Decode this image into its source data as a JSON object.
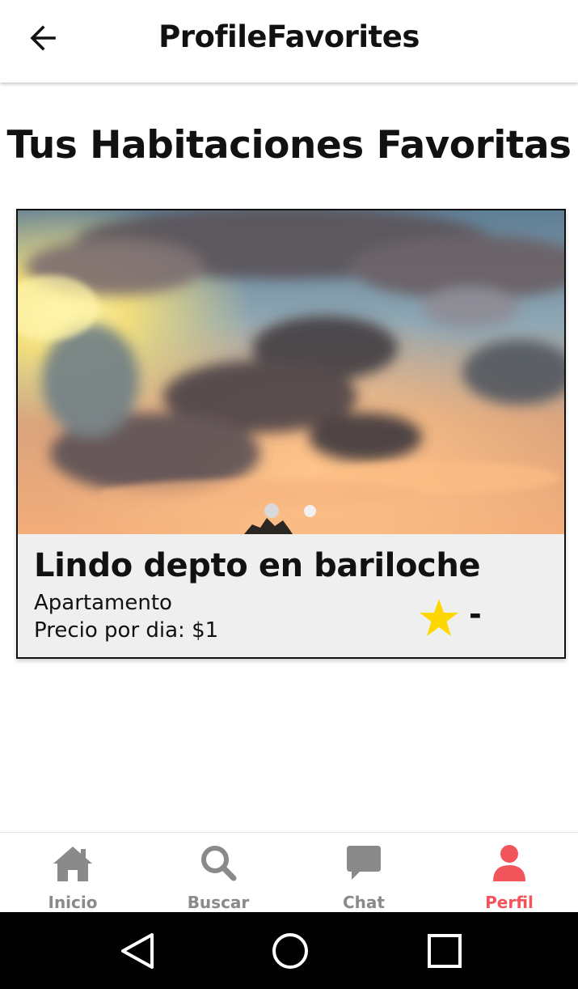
{
  "header": {
    "title": "ProfileFavorites",
    "back_icon": "arrow-left-icon"
  },
  "page": {
    "heading": "Tus Habitaciones Favoritas"
  },
  "favorites": [
    {
      "title": "Lindo depto en bariloche",
      "type": "Apartamento",
      "price": "Precio por dia: $1",
      "rating": "-",
      "rating_icon": "star-icon",
      "photo_count": 2,
      "active_photo": 1
    }
  ],
  "tabs": [
    {
      "label": "Inicio",
      "icon": "home-icon",
      "active": false
    },
    {
      "label": "Buscar",
      "icon": "search-icon",
      "active": false
    },
    {
      "label": "Chat",
      "icon": "chat-bubble-icon",
      "active": false
    },
    {
      "label": "Perfil",
      "icon": "person-icon",
      "active": true
    }
  ],
  "system_nav": {
    "back": "triangle-back-icon",
    "home": "circle-home-icon",
    "recents": "square-recents-icon"
  },
  "colors": {
    "accent": "#f2545b",
    "inactive_tab": "#8a8a8a",
    "card_background": "#efefef",
    "star": "#ffd700"
  }
}
